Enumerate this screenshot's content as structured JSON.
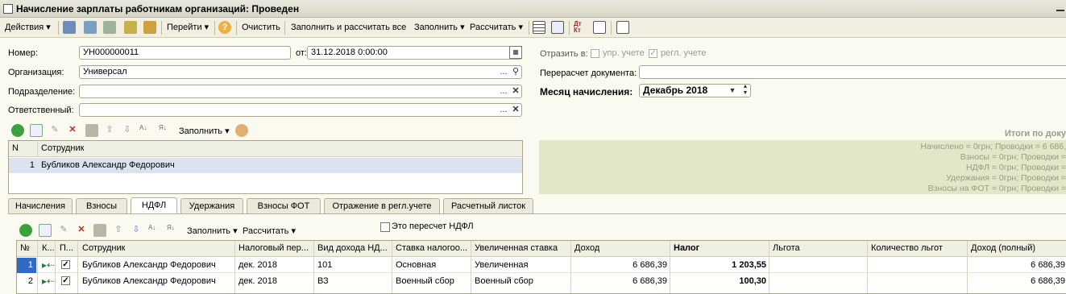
{
  "window": {
    "title": "Начисление зарплаты работникам организаций: Проведен"
  },
  "toolbar": {
    "actions": "Действия",
    "goto": "Перейти",
    "help": "?",
    "clear": "Очистить",
    "fill_calc_all": "Заполнить и рассчитать все",
    "fill": "Заполнить",
    "calculate": "Рассчитать"
  },
  "header": {
    "number_label": "Номер:",
    "number_value": "УН000000011",
    "date_label": "от:",
    "date_value": "31.12.2018  0:00:00",
    "org_label": "Организация:",
    "org_value": "Универсал",
    "dept_label": "Подразделение:",
    "dept_value": "",
    "resp_label": "Ответственный:",
    "resp_value": "",
    "reflect_label": "Отразить в:",
    "mgmt_label": "упр. учете",
    "reg_label": "регл. учете",
    "recalc_label": "Перерасчет документа:",
    "recalc_value": "",
    "month_label": "Месяц начисления:",
    "month_value": "Декабрь 2018"
  },
  "employees_toolbar": {
    "fill": "Заполнить"
  },
  "employees": {
    "columns": [
      "N",
      "Сотрудник"
    ],
    "rows": [
      {
        "n": "1",
        "name": "Бубликов Александр Федорович"
      }
    ]
  },
  "totals": {
    "title": "Итоги по доку",
    "lines": [
      "Начислено = 0грн;  Проводки = 6 686,",
      "Взносы = 0грн;  Проводки =",
      "НДФЛ = 0грн;  Проводки =",
      "Удержания = 0грн;  Проводки =",
      "Взносы на ФОТ = 0грн;  Проводки ="
    ]
  },
  "tabs": [
    "Начисления",
    "Взносы",
    "НДФЛ",
    "Удержания",
    "Взносы ФОТ",
    "Отражение в регл.учете",
    "Расчетный листок"
  ],
  "ndfl": {
    "fill": "Заполнить",
    "calculate": "Рассчитать",
    "recalc_check": "Это пересчет НДФЛ",
    "columns": [
      "№",
      "К...",
      "П...",
      "Сотрудник",
      "Налоговый пер...",
      "Вид дохода НД...",
      "Ставка налогоо...",
      "Увеличенная ставка",
      "Доход",
      "Налог",
      "Льгота",
      "Количество льгот",
      "Доход (полный)"
    ],
    "rows": [
      {
        "n": "1",
        "employee": "Бубликов Александр Федорович",
        "period": "дек. 2018",
        "income_type": "101",
        "rate": "Основная",
        "inc_rate": "Увеличенная",
        "income": "6 686,39",
        "tax": "1 203,55",
        "benefit": "",
        "benefit_count": "",
        "income_full": "6 686,39"
      },
      {
        "n": "2",
        "employee": "Бубликов Александр Федорович",
        "period": "дек. 2018",
        "income_type": "ВЗ",
        "rate": "Военный сбор",
        "inc_rate": "Военный сбор",
        "income": "6 686,39",
        "tax": "100,30",
        "benefit": "",
        "benefit_count": "",
        "income_full": "6 686,39"
      }
    ]
  },
  "colors": {
    "accent": "#316ac5",
    "panel": "#e4e6c8",
    "background": "#fbfaf0"
  }
}
